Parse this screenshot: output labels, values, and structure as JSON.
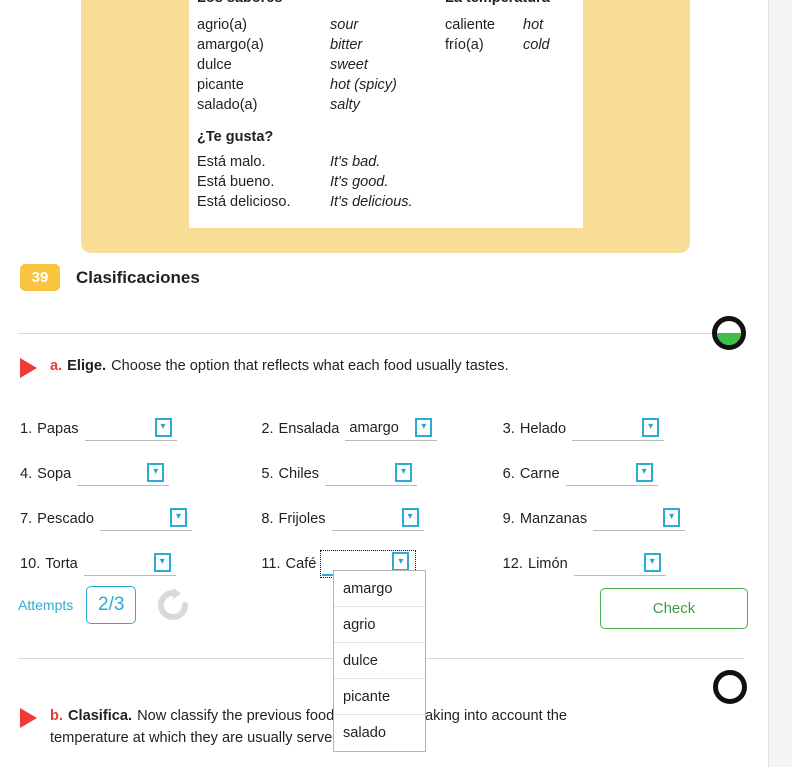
{
  "vocabulary": {
    "headers": [
      "Los sabores",
      "La temperatura"
    ],
    "sabores": [
      {
        "es": "agrio(a)",
        "en": "sour"
      },
      {
        "es": "amargo(a)",
        "en": "bitter"
      },
      {
        "es": "dulce",
        "en": "sweet"
      },
      {
        "es": "picante",
        "en": "hot (spicy)"
      },
      {
        "es": "salado(a)",
        "en": "salty"
      }
    ],
    "temperatura": [
      {
        "es": "caliente",
        "en": "hot"
      },
      {
        "es": "frío(a)",
        "en": "cold"
      }
    ],
    "gusta_header": "¿Te gusta?",
    "gusta": [
      {
        "es": "Está malo.",
        "en": "It's bad."
      },
      {
        "es": "Está bueno.",
        "en": "It's good."
      },
      {
        "es": "Está delicioso.",
        "en": "It's delicious."
      }
    ]
  },
  "section": {
    "number": "39",
    "title": "Clasificaciones"
  },
  "activity_a": {
    "letter": "a.",
    "verb": "Elige.",
    "text": "Choose the option that reflects what each food usually tastes.",
    "items": [
      {
        "num": "1.",
        "label": "Papas",
        "value": ""
      },
      {
        "num": "2.",
        "label": "Ensalada",
        "value": "amargo"
      },
      {
        "num": "3.",
        "label": "Helado",
        "value": ""
      },
      {
        "num": "4.",
        "label": "Sopa",
        "value": ""
      },
      {
        "num": "5.",
        "label": "Chiles",
        "value": ""
      },
      {
        "num": "6.",
        "label": "Carne",
        "value": ""
      },
      {
        "num": "7.",
        "label": "Pescado",
        "value": ""
      },
      {
        "num": "8.",
        "label": "Frijoles",
        "value": ""
      },
      {
        "num": "9.",
        "label": "Manzanas",
        "value": ""
      },
      {
        "num": "10.",
        "label": "Torta",
        "value": ""
      },
      {
        "num": "11.",
        "label": "Café",
        "value": ""
      },
      {
        "num": "12.",
        "label": "Limón",
        "value": ""
      }
    ],
    "open_dropdown_index": 10,
    "dropdown_options": [
      "amargo",
      "agrio",
      "dulce",
      "picante",
      "salado"
    ],
    "attempts_label": "Attempts",
    "attempts_value": "2/3",
    "check_label": "Check",
    "progress_percent": 50
  },
  "activity_b": {
    "letter": "b.",
    "verb": "Clasifica.",
    "line1": "Now classify the previous foods and drinks, taking into account the",
    "line2": "temperature at which they are usually served.",
    "progress_percent": 0
  },
  "colors": {
    "panel_yellow": "#f8dd96",
    "badge_gold": "#f9c440",
    "accent_teal": "#2bacd4",
    "accent_red": "#ef3b36",
    "accent_green": "#4caf50",
    "progress_green": "#3fbf4a"
  }
}
